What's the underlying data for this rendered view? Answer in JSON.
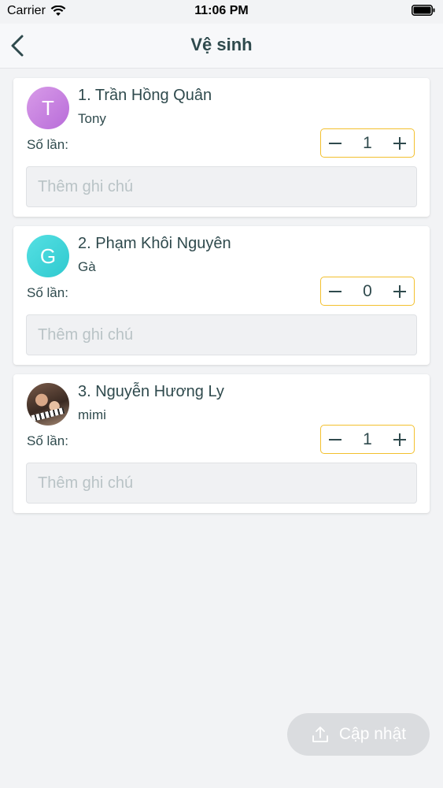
{
  "status_bar": {
    "carrier": "Carrier",
    "time": "11:06 PM"
  },
  "nav": {
    "title": "Vệ sinh",
    "back_icon": "chevron-left-icon"
  },
  "members": [
    {
      "avatar_initial": "T",
      "avatar_color": "#c27fdf",
      "name": "1. Trần Hồng Quân",
      "nickname": "Tony",
      "count_label": "Số lần:",
      "count": "1",
      "note_placeholder": "Thêm ghi chú"
    },
    {
      "avatar_initial": "G",
      "avatar_color": "#3fd4d8",
      "name": "2. Phạm Khôi Nguyên",
      "nickname": "Gà",
      "count_label": "Số lần:",
      "count": "0",
      "note_placeholder": "Thêm ghi chú"
    },
    {
      "avatar_initial": "",
      "avatar_color": "photo",
      "name": "3. Nguyễn Hương Ly",
      "nickname": "mimi",
      "count_label": "Số lần:",
      "count": "1",
      "note_placeholder": "Thêm ghi chú"
    }
  ],
  "actions": {
    "update_label": "Cập nhật",
    "update_icon": "upload-icon"
  },
  "colors": {
    "accent_border": "#f3c02e",
    "text": "#2f4a4d",
    "background": "#f2f3f5"
  }
}
